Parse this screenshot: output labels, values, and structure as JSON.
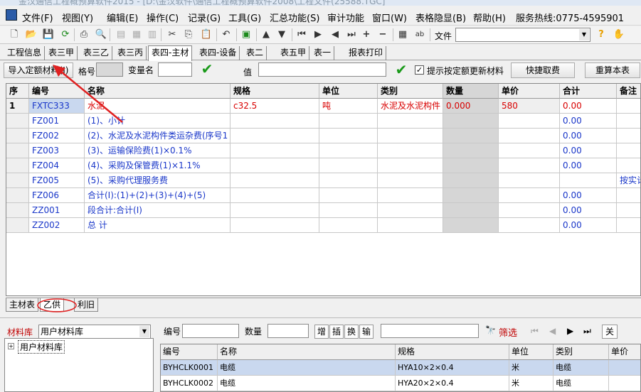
{
  "title": "金汉通信工程概预算软件2015 - [D:\\金汉软件\\通信工程概预算软件2008\\工程文件(25588.TGC]",
  "menu": [
    "文件(F)",
    "视图(Y)",
    "编辑(E)",
    "操作(C)",
    "记录(G)",
    "工具(G)",
    "汇总功能(S)",
    "审计功能",
    "窗口(W)",
    "表格隐显(B)",
    "帮助(H)",
    "服务热线:0775-4595901"
  ],
  "toolbar": {
    "file_label": "文件"
  },
  "tabs": [
    "工程信息",
    "表三甲",
    "表三乙",
    "表三丙",
    "表四-主材",
    "表四-设备",
    "表二",
    "表五甲",
    "表一",
    "报表打印"
  ],
  "active_tab": 4,
  "filter": {
    "import_button": "导入定额材料(I)",
    "spec_label": "格号",
    "varname_label": "变量名",
    "value_label": "值",
    "checkbox_label": "提示按定额更新材料",
    "quick_fee_button": "快捷取费",
    "recalc_button": "重算本表"
  },
  "grid": {
    "headers": [
      "序",
      "编号",
      "名称",
      "规格",
      "单位",
      "类别",
      "数量",
      "单价",
      "合计",
      "备注"
    ],
    "rows": [
      {
        "seq": "1",
        "code": "FXTC333",
        "name": "水泥",
        "spec": "c32.5",
        "unit": "吨",
        "category": "水泥及水泥构件",
        "qty": "0.000",
        "price": "580",
        "total": "0.00",
        "note": ""
      },
      {
        "seq": "",
        "code": "FZ001",
        "name": "(1)、小计",
        "spec": "",
        "unit": "",
        "category": "",
        "qty": "",
        "price": "",
        "total": "0.00",
        "note": ""
      },
      {
        "seq": "",
        "code": "FZ002",
        "name": "(2)、水泥及水泥构件类运杂费(序号1",
        "spec": "",
        "unit": "",
        "category": "",
        "qty": "",
        "price": "",
        "total": "0.00",
        "note": ""
      },
      {
        "seq": "",
        "code": "FZ003",
        "name": "(3)、运输保险费(1)×0.1%",
        "spec": "",
        "unit": "",
        "category": "",
        "qty": "",
        "price": "",
        "total": "0.00",
        "note": ""
      },
      {
        "seq": "",
        "code": "FZ004",
        "name": "(4)、采购及保管费(1)×1.1%",
        "spec": "",
        "unit": "",
        "category": "",
        "qty": "",
        "price": "",
        "total": "0.00",
        "note": ""
      },
      {
        "seq": "",
        "code": "FZ005",
        "name": "(5)、采购代理服务费",
        "spec": "",
        "unit": "",
        "category": "",
        "qty": "",
        "price": "",
        "total": "",
        "note": "按实计"
      },
      {
        "seq": "",
        "code": "FZ006",
        "name": "合计(Ⅰ):(1)+(2)+(3)+(4)+(5)",
        "spec": "",
        "unit": "",
        "category": "",
        "qty": "",
        "price": "",
        "total": "0.00",
        "note": ""
      },
      {
        "seq": "",
        "code": "ZZ001",
        "name": "段合计:合计(Ⅰ)",
        "spec": "",
        "unit": "",
        "category": "",
        "qty": "",
        "price": "",
        "total": "0.00",
        "note": ""
      },
      {
        "seq": "",
        "code": "ZZ002",
        "name": "总    计",
        "spec": "",
        "unit": "",
        "category": "",
        "qty": "",
        "price": "",
        "total": "0.00",
        "note": ""
      }
    ]
  },
  "bottom_tabs": [
    "主材表",
    "乙供",
    "利旧"
  ],
  "lower": {
    "library_label": "材料库",
    "library_value": "用户材料库",
    "tree_root": "用户材料库",
    "code_label": "编号",
    "qty_label": "数量",
    "buttons": [
      "增",
      "插",
      "换",
      "输"
    ],
    "filter_label": "筛选",
    "close_label": "关",
    "headers": [
      "编号",
      "名称",
      "规格",
      "单位",
      "类别",
      "单价"
    ],
    "rows": [
      {
        "code": "BYHCLK0001",
        "name": "电缆",
        "spec": "HYA10×2×0.4",
        "unit": "米",
        "category": "电缆",
        "price": ""
      },
      {
        "code": "BYHCLK0002",
        "name": "电缆",
        "spec": "HYA20×2×0.4",
        "unit": "米",
        "category": "电缆",
        "price": ""
      }
    ]
  }
}
